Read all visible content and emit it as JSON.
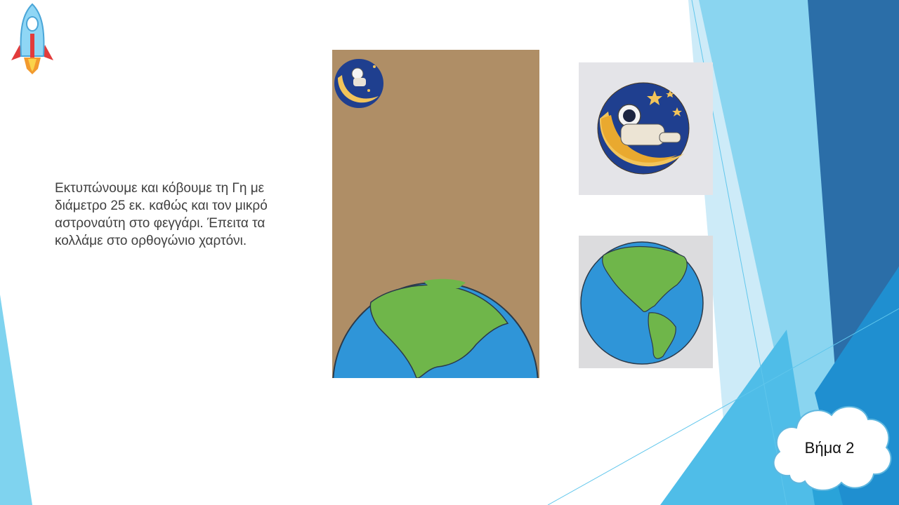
{
  "slide": {
    "body_text": "Εκτυπώνουμε και κόβουμε τη Γη με διάμετρο 25 εκ. καθώς και τον μικρό αστροναύτη στο φεγγάρι. Έπειτα τα κολλάμε στο ορθογώνιο χαρτόνι.",
    "step_label": "Βήμα 2"
  },
  "icons": {
    "logo": "rocket-icon",
    "moon": "moon-astronaut-icon",
    "earth": "earth-icon"
  },
  "colors": {
    "accent_light": "#7fd3ef",
    "accent_mid": "#2aa3d9",
    "accent_dark": "#2b6ea8",
    "cardboard": "#ad8b63",
    "ocean": "#2f95d8",
    "land": "#6fb64a"
  }
}
